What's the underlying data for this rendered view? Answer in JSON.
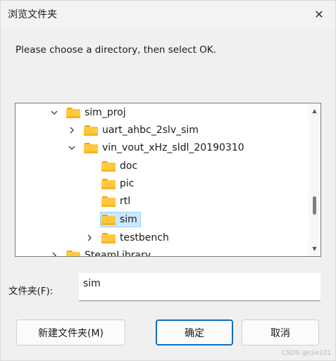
{
  "window": {
    "title": "浏览文件夹",
    "close_glyph": "✕"
  },
  "prompt": "Please choose a directory, then select OK.",
  "tree": {
    "rows": [
      {
        "label": "sim_proj",
        "expander": "chevron-down",
        "selected": false
      },
      {
        "label": "uart_ahbc_2slv_sim",
        "expander": "chevron-right",
        "selected": false
      },
      {
        "label": "vin_vout_xHz_sldl_20190310",
        "expander": "chevron-down",
        "selected": false
      },
      {
        "label": "doc",
        "expander": "none",
        "selected": false
      },
      {
        "label": "pic",
        "expander": "none",
        "selected": false
      },
      {
        "label": "rtl",
        "expander": "none",
        "selected": false
      },
      {
        "label": "sim",
        "expander": "none",
        "selected": true
      },
      {
        "label": "testbench",
        "expander": "chevron-right",
        "selected": false
      },
      {
        "label": "SteamLibrary",
        "expander": "chevron-right",
        "selected": false
      }
    ]
  },
  "folder_field": {
    "label": "文件夹(F):",
    "value": "sim"
  },
  "buttons": {
    "new_folder": "新建文件夹(M)",
    "ok": "确定",
    "cancel": "取消"
  },
  "watermark": "CSDN @cjie221",
  "colors": {
    "accent": "#0f6cbd",
    "selection": "#cce8ff",
    "folder": "#ffc83d"
  }
}
